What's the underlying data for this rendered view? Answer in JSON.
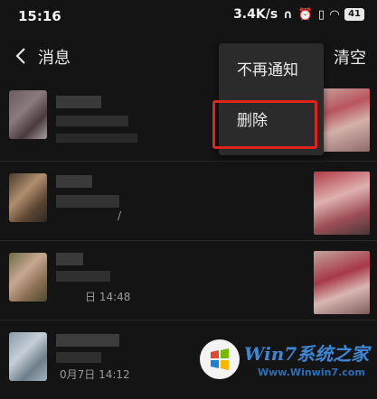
{
  "status": {
    "time": "15:16",
    "speed": "3.4K/s",
    "battery": "41"
  },
  "header": {
    "title": "消息",
    "clear_label": "清空"
  },
  "popup": {
    "items": [
      {
        "label": "不再通知"
      },
      {
        "label": "删除"
      }
    ]
  },
  "rows": [
    {
      "meta": ""
    },
    {
      "meta": "/"
    },
    {
      "meta": "日 14:48"
    },
    {
      "meta": "0月7日 14:12"
    }
  ],
  "watermark": {
    "brand": "Win7系统之家",
    "site": "Www.Winwin7.com"
  },
  "colors": {
    "background": "#141414",
    "highlight": "#e0241b",
    "popup": "#2b2b2b"
  }
}
